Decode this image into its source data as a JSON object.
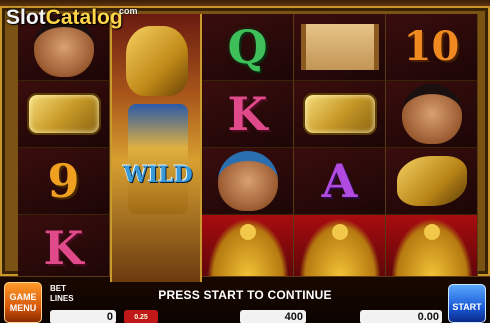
{
  "watermark": {
    "brand": "Slot",
    "brand_accent": "Catalog",
    "suffix": "com"
  },
  "reels": {
    "symbols": [
      [
        "goddess",
        "horus-wild",
        "Q",
        "scroll",
        "10"
      ],
      [
        "gold-plate",
        "horus-wild",
        "K",
        "gold-plate",
        "goddess"
      ],
      [
        "9",
        "horus-wild",
        "pharaoh",
        "A",
        "eagle"
      ],
      [
        "K",
        "horus-wild",
        "isis",
        "isis",
        "isis"
      ]
    ],
    "wild_label": "WILD",
    "letters": {
      "q": "Q",
      "k1": "K",
      "k2": "K",
      "a": "A",
      "nine": "9",
      "ten": "10"
    }
  },
  "controls": {
    "menu_label": "GAME MENU",
    "bet_label": "BET",
    "lines_label": "LINES",
    "lines_value": "0",
    "bet_value": "0.25",
    "message": "PRESS START TO CONTINUE",
    "credit_value": "400",
    "win_value": "0.00",
    "start_label": "START"
  },
  "colors": {
    "start": "#1a5ad8",
    "menu": "#d85a0a",
    "wild_text": "#3a9ad8"
  }
}
